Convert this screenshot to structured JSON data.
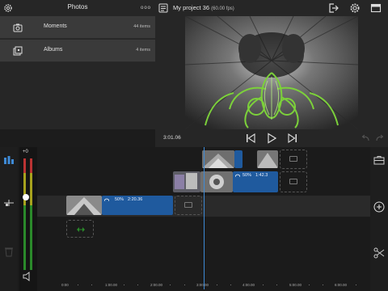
{
  "library": {
    "title": "Photos",
    "more_glyph": "ooo",
    "rows": [
      {
        "label": "Moments",
        "count": "44 items",
        "icon": "camera-icon"
      },
      {
        "label": "Albums",
        "count": "4 items",
        "icon": "albums-icon"
      }
    ]
  },
  "project": {
    "title": "My project 36",
    "fps": "(60.00 fps)"
  },
  "transport": {
    "timecode": "3:01.06"
  },
  "meter": {
    "value": "+0"
  },
  "clips": [
    {
      "speed": "50%",
      "duration": "2:20.36"
    },
    {
      "speed": "50%",
      "duration": "1:42.3"
    }
  ],
  "ruler": [
    "0:00",
    "1:00.00",
    "2:00.00",
    "3:00.00",
    "4:00.00",
    "5:00.00",
    "6:00.00"
  ],
  "colors": {
    "clip": "#1f5a9e",
    "playhead": "#3e8ad6",
    "accent_green": "#7cd13a"
  }
}
